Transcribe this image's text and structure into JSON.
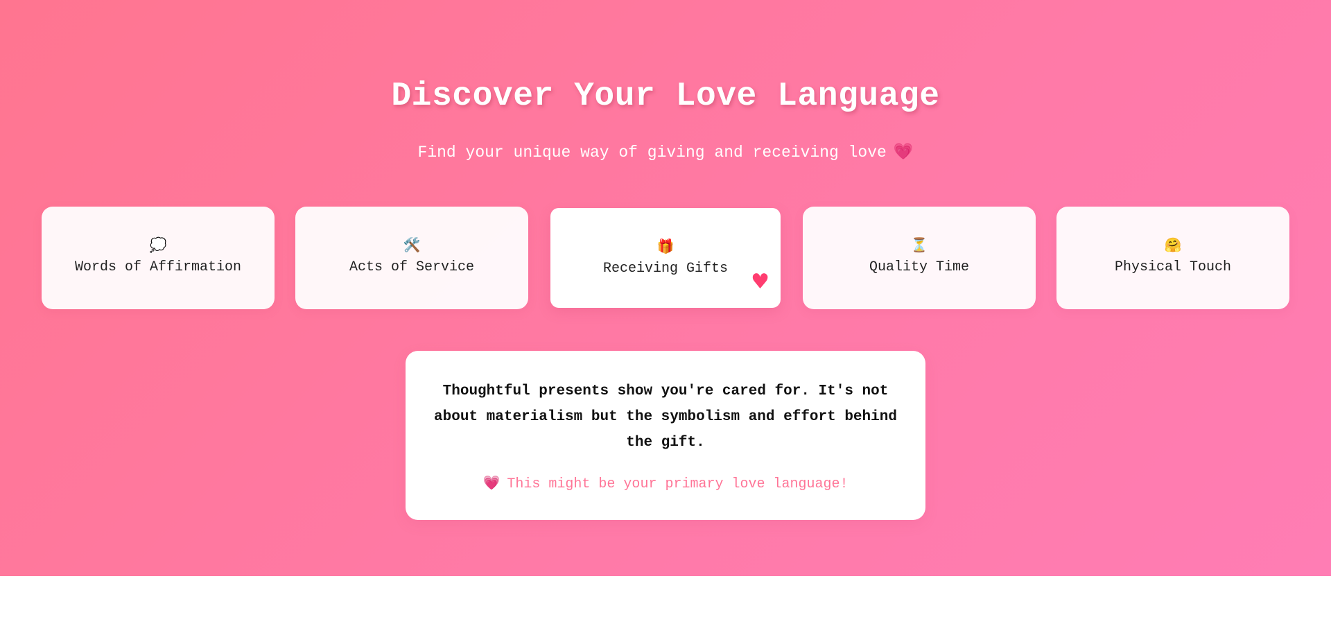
{
  "header": {
    "title": "Discover Your Love Language",
    "subtitle": "Find your unique way of giving and receiving love",
    "subtitle_emoji": "💗"
  },
  "cards": [
    {
      "icon": "💭",
      "icon_name": "thought-bubble-icon",
      "label": "Words of Affirmation",
      "selected": false
    },
    {
      "icon": "🛠️",
      "icon_name": "tools-icon",
      "label": "Acts of Service",
      "selected": false
    },
    {
      "icon": "🎁",
      "icon_name": "gift-icon",
      "label": "Receiving Gifts",
      "selected": true,
      "badge": "♥"
    },
    {
      "icon": "⏳",
      "icon_name": "hourglass-icon",
      "label": "Quality Time",
      "selected": false
    },
    {
      "icon": "🤗",
      "icon_name": "hug-icon",
      "label": "Physical Touch",
      "selected": false
    }
  ],
  "result": {
    "description": "Thoughtful presents show you're cared for. It's not about materialism but the symbolism and effort behind the gift.",
    "hint_emoji": "💗",
    "hint": "This might be your primary love language!"
  },
  "colors": {
    "background_start": "#ff7590",
    "background_end": "#ff7db4",
    "accent": "#ff7597",
    "heart": "#ff3d70"
  }
}
